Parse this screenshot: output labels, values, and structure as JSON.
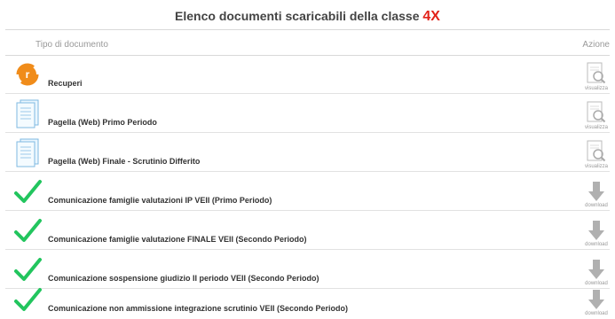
{
  "header": {
    "title": "Elenco documenti scaricabili della classe",
    "class_name": "4X",
    "col_type": "Tipo di documento",
    "col_action": "Azione"
  },
  "rows": [
    {
      "label": "Recuperi",
      "icon": "refresh-r-icon",
      "action": "visualizza"
    },
    {
      "label": "Pagella (Web) Primo Periodo",
      "icon": "document-icon",
      "action": "visualizza"
    },
    {
      "label": "Pagella (Web) Finale - Scrutinio Differito",
      "icon": "document-icon",
      "action": "visualizza"
    },
    {
      "label": "Comunicazione famiglie valutazioni IP VEII (Primo Periodo)",
      "icon": "checkmark-icon",
      "action": "download"
    },
    {
      "label": "Comunicazione famiglie valutazione FINALE VEII (Secondo Periodo)",
      "icon": "checkmark-icon",
      "action": "download"
    },
    {
      "label": "Comunicazione sospensione giudizio II periodo VEII (Secondo Periodo)",
      "icon": "checkmark-icon",
      "action": "download"
    },
    {
      "label": "Comunicazione non ammissione integrazione scrutinio VEII (Secondo Periodo)",
      "icon": "checkmark-icon",
      "action": "download"
    }
  ],
  "colors": {
    "accent_class": "#e2231a",
    "check_green": "#22c55e",
    "orange": "#f08c1a"
  }
}
